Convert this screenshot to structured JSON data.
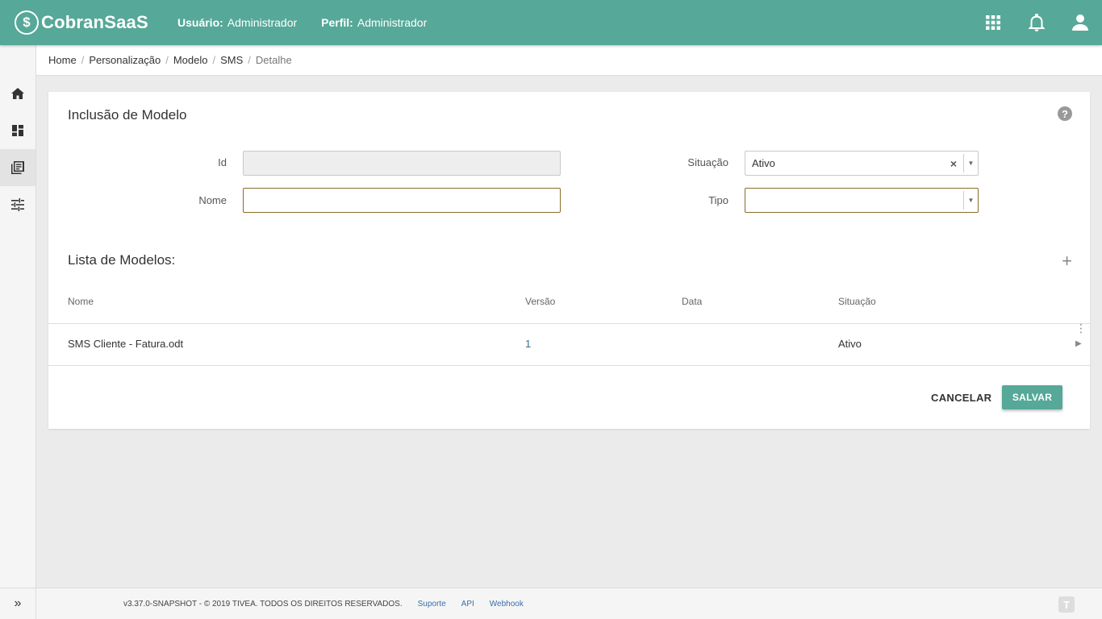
{
  "app": {
    "name": "CobranSaaS",
    "brand_color": "#56a898"
  },
  "header": {
    "user_label": "Usuário:",
    "user_value": "Administrador",
    "profile_label": "Perfil:",
    "profile_value": "Administrador",
    "icons": [
      "apps-grid-icon",
      "bell-icon",
      "user-icon"
    ]
  },
  "sidebar": {
    "items": [
      {
        "icon": "home-icon",
        "active": false
      },
      {
        "icon": "dashboard-icon",
        "active": false
      },
      {
        "icon": "library-books-icon",
        "active": true
      },
      {
        "icon": "tune-icon",
        "active": false
      }
    ],
    "expand_label": "»"
  },
  "breadcrumb": [
    "Home",
    "Personalização",
    "Modelo",
    "SMS",
    "Detalhe"
  ],
  "form": {
    "title": "Inclusão de Modelo",
    "id_label": "Id",
    "id_value": "",
    "nome_label": "Nome",
    "nome_value": "",
    "situacao_label": "Situação",
    "situacao_value": "Ativo",
    "situacao_clear": "×",
    "tipo_label": "Tipo",
    "tipo_value": ""
  },
  "list": {
    "title": "Lista de Modelos:",
    "add_label": "+",
    "columns": [
      "Nome",
      "Versão",
      "Data",
      "Situação"
    ],
    "rows": [
      {
        "nome": "SMS Cliente - Fatura.odt",
        "versao": "1",
        "data": "",
        "situacao": "Ativo"
      }
    ]
  },
  "actions": {
    "cancel": "CANCELAR",
    "save": "SALVAR"
  },
  "footer": {
    "copyright": "v3.37.0-SNAPSHOT - © 2019 TIVEA. TODOS OS DIREITOS RESERVADOS.",
    "links": [
      "Suporte",
      "API",
      "Webhook"
    ]
  }
}
